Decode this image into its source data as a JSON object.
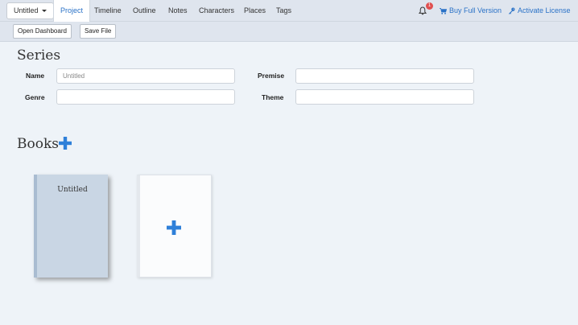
{
  "topbar": {
    "project_menu": "Untitled",
    "tabs": [
      {
        "label": "Project"
      },
      {
        "label": "Timeline"
      },
      {
        "label": "Outline"
      },
      {
        "label": "Notes"
      },
      {
        "label": "Characters"
      },
      {
        "label": "Places"
      },
      {
        "label": "Tags"
      }
    ],
    "notification_count": "1",
    "buy_link": "Buy Full Version",
    "license_link": "Activate License"
  },
  "toolbar": {
    "open_dashboard": "Open Dashboard",
    "save_file": "Save File"
  },
  "series": {
    "heading": "Series",
    "name_label": "Name",
    "name_placeholder": "Untitled",
    "premise_label": "Premise",
    "genre_label": "Genre",
    "theme_label": "Theme"
  },
  "books": {
    "heading": "Books",
    "items": [
      {
        "title": "Untitled"
      }
    ]
  },
  "colors": {
    "accent": "#2a72c7",
    "plus": "#2f80d9",
    "badge": "#e05050"
  }
}
